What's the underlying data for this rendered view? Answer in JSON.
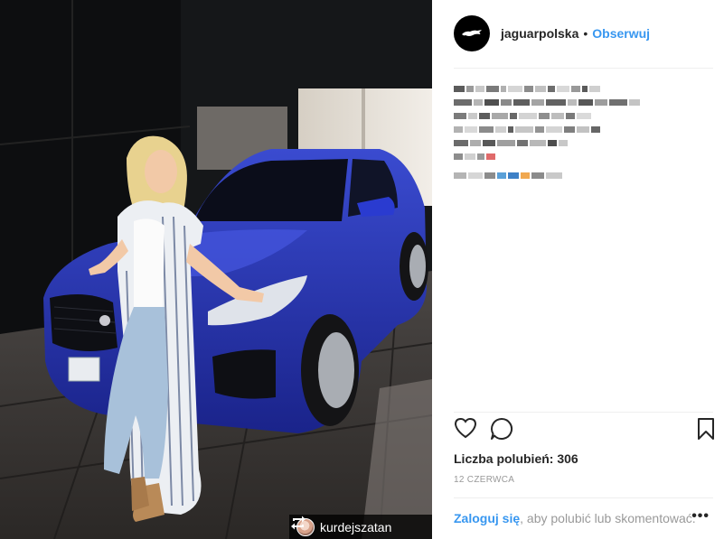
{
  "post": {
    "username": "jaguarpolska",
    "separator": "•",
    "follow_label": "Obserwuj",
    "likes_text": "Liczba polubień: 306",
    "date": "12 CZERWCA",
    "login_link": "Zaloguj się",
    "login_text": ", aby polubić lub skomentować.",
    "more_label": "•••"
  },
  "photo": {
    "repost_username": "kurdejszatan",
    "car_color": "#2a3bb0"
  },
  "icons": {
    "like": "heart-icon",
    "comment": "speech-bubble-icon",
    "save": "bookmark-icon",
    "repost": "repost-icon",
    "more": "ellipsis-icon"
  },
  "colors": {
    "link_blue": "#3897f0",
    "text": "#262626",
    "muted": "#999999"
  }
}
